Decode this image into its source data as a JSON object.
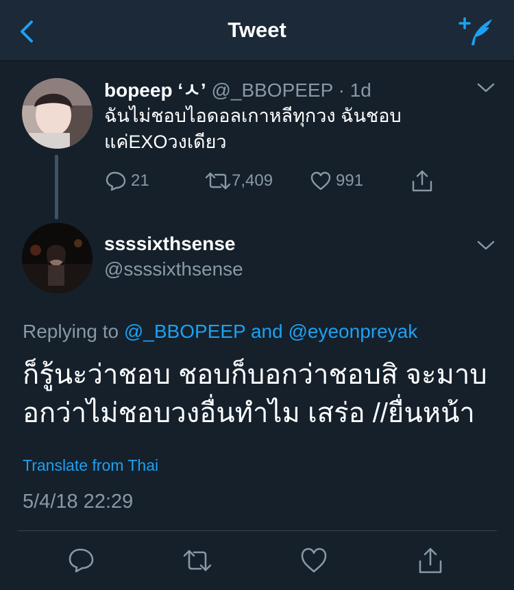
{
  "header": {
    "title": "Tweet",
    "back_icon": "chevron-left-icon",
    "compose_icon": "compose-tweet-icon",
    "accent": "#1da1f2"
  },
  "parent_tweet": {
    "name": "bopeep ‘ㅅ’",
    "handle": "@_BBOPEEP",
    "separator": "·",
    "age": "1d",
    "text_line1": "ฉันไม่ชอบไอดอลเกาหลีทุกวง ฉันชอบ",
    "text_line2": "แค่EXOวงเดียว",
    "reply_count": "21",
    "retweet_count": "7,409",
    "like_count": "991"
  },
  "main_tweet": {
    "name": "ssssixthsense",
    "handle": "@ssssixthsense",
    "replying_prefix": "Replying to",
    "replying_user1": "@_BBOPEEP",
    "replying_and": "and",
    "replying_user2": "@eyeonpreyak",
    "text_line1": "ก็รู้นะว่าชอบ ชอบก็บอกว่าชอบสิ จะมาบ",
    "text_line2": "อกว่าไม่ชอบวงอื่นทำไม เสร่อ //ยื่นหน้า",
    "translate_label": "Translate from Thai",
    "timestamp": "5/4/18 22:29"
  },
  "colors": {
    "background": "#15202b",
    "header": "#1c2938",
    "muted": "#8899a6",
    "link": "#1da1f2"
  }
}
